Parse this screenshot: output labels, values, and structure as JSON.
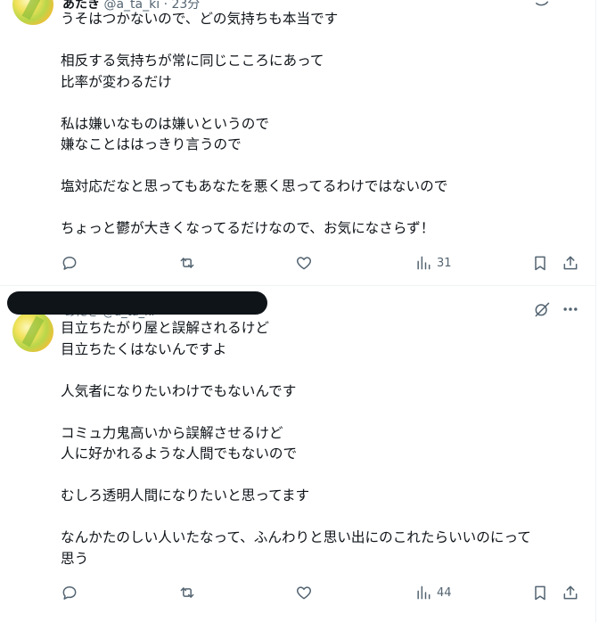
{
  "tweets": [
    {
      "header": {
        "name": "あたき",
        "handle": "@a_ta_ki",
        "time": "23分"
      },
      "text": "うそはつかないので、どの気持ちも本当です\n\n相反する気持ちが常に同じこころにあって\n比率が変わるだけ\n\n私は嫌いなものは嫌いというので\n嫌なことははっきり言うので\n\n塩対応だなと思ってもあなたを悪く思ってるわけではないので\n\nちょっと鬱が大きくなってるだけなので、お気になさらず！",
      "actions": {
        "views": "31"
      }
    },
    {
      "header_peek": "あたき @a_ta_ki",
      "text": "目立ちたがり屋と誤解されるけど\n目立ちたくはないんですよ\n\n人気者になりたいわけでもないんです\n\nコミュ力鬼高いから誤解させるけど\n人に好かれるような人間でもないので\n\nむしろ透明人間になりたいと思ってます\n\nなんかたのしい人いたなって、ふんわりと思い出にのこれたらいいのにって\n思う",
      "actions": {
        "views": "44"
      }
    }
  ],
  "icons": [
    "reply-icon",
    "retweet-icon",
    "like-icon",
    "views-icon",
    "bookmark-icon",
    "share-icon",
    "grok-icon",
    "more-icon"
  ],
  "colors": {
    "text": "#0f1419",
    "muted": "#536471",
    "border": "#eff3f4"
  }
}
